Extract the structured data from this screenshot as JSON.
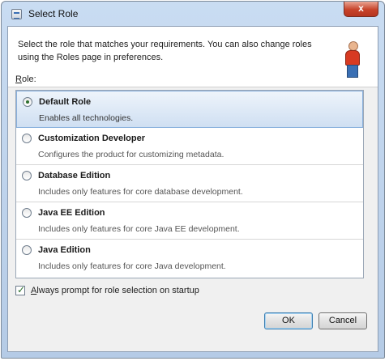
{
  "window": {
    "title": "Select Role",
    "close_glyph": "x"
  },
  "header": {
    "text": "Select the role that matches your requirements. You can also change roles using the Roles page in preferences.",
    "icon": "person-icon"
  },
  "role_label": {
    "mnemonic": "R",
    "rest": "ole:"
  },
  "roles": [
    {
      "name": "Default Role",
      "description": "Enables all technologies.",
      "selected": true
    },
    {
      "name": "Customization Developer",
      "description": "Configures the product for customizing metadata.",
      "selected": false
    },
    {
      "name": "Database Edition",
      "description": "Includes only features for core database development.",
      "selected": false
    },
    {
      "name": "Java EE Edition",
      "description": "Includes only features for core Java EE development.",
      "selected": false
    },
    {
      "name": "Java Edition",
      "description": "Includes only features for core Java development.",
      "selected": false
    }
  ],
  "always_prompt": {
    "mnemonic": "A",
    "rest": "lways prompt for role selection on startup",
    "checked": true
  },
  "buttons": {
    "ok": "OK",
    "cancel": "Cancel"
  },
  "colors": {
    "selection": "#cfdff2",
    "title_bar": "#c9dcf2",
    "close": "#c7432a"
  }
}
